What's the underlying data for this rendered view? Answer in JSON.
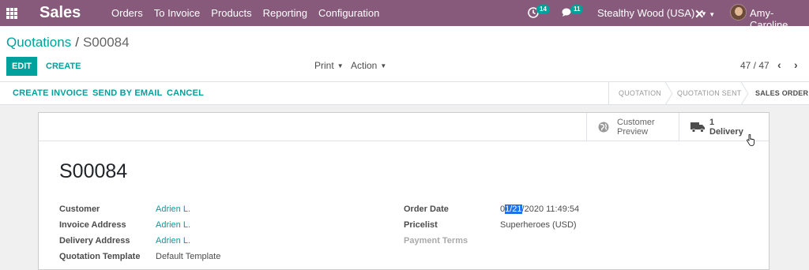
{
  "navbar": {
    "app_name": "Sales",
    "menu": [
      "Orders",
      "To Invoice",
      "Products",
      "Reporting",
      "Configuration"
    ],
    "activity_count": "14",
    "message_count": "11",
    "company": "Stealthy Wood (USA)",
    "user": "Amy-Caroline",
    "color": "#875a7b"
  },
  "breadcrumb": {
    "parent": "Quotations",
    "separator": "/",
    "current": "S00084"
  },
  "control": {
    "edit": "EDIT",
    "create": "CREATE",
    "print": "Print",
    "action": "Action",
    "pager": "47 / 47"
  },
  "statusbar": {
    "buttons": [
      "CREATE INVOICE",
      "SEND BY EMAIL",
      "CANCEL"
    ],
    "stages": [
      "QUOTATION",
      "QUOTATION SENT",
      "SALES ORDER"
    ],
    "active_stage": "SALES ORDER"
  },
  "smart_buttons": {
    "preview_line1": "Customer",
    "preview_line2": "Preview",
    "delivery_count": "1",
    "delivery_label": "Delivery"
  },
  "record": {
    "name": "S00084",
    "left_fields": [
      {
        "label": "Customer",
        "value": "Adrien L."
      },
      {
        "label": "Invoice Address",
        "value": "Adrien L."
      },
      {
        "label": "Delivery Address",
        "value": "Adrien L."
      },
      {
        "label": "Quotation Template",
        "value": "Default Template"
      }
    ],
    "order_date_label": "Order Date",
    "order_date_pre": "0",
    "order_date_selected": "1/21",
    "order_date_post": "/2020 11:49:54",
    "pricelist_label": "Pricelist",
    "pricelist_value": "Superheroes (USD)",
    "payment_terms_label": "Payment Terms"
  },
  "colors": {
    "accent": "#00a09d",
    "brand": "#875a7b",
    "selection": "#1e73e8"
  }
}
